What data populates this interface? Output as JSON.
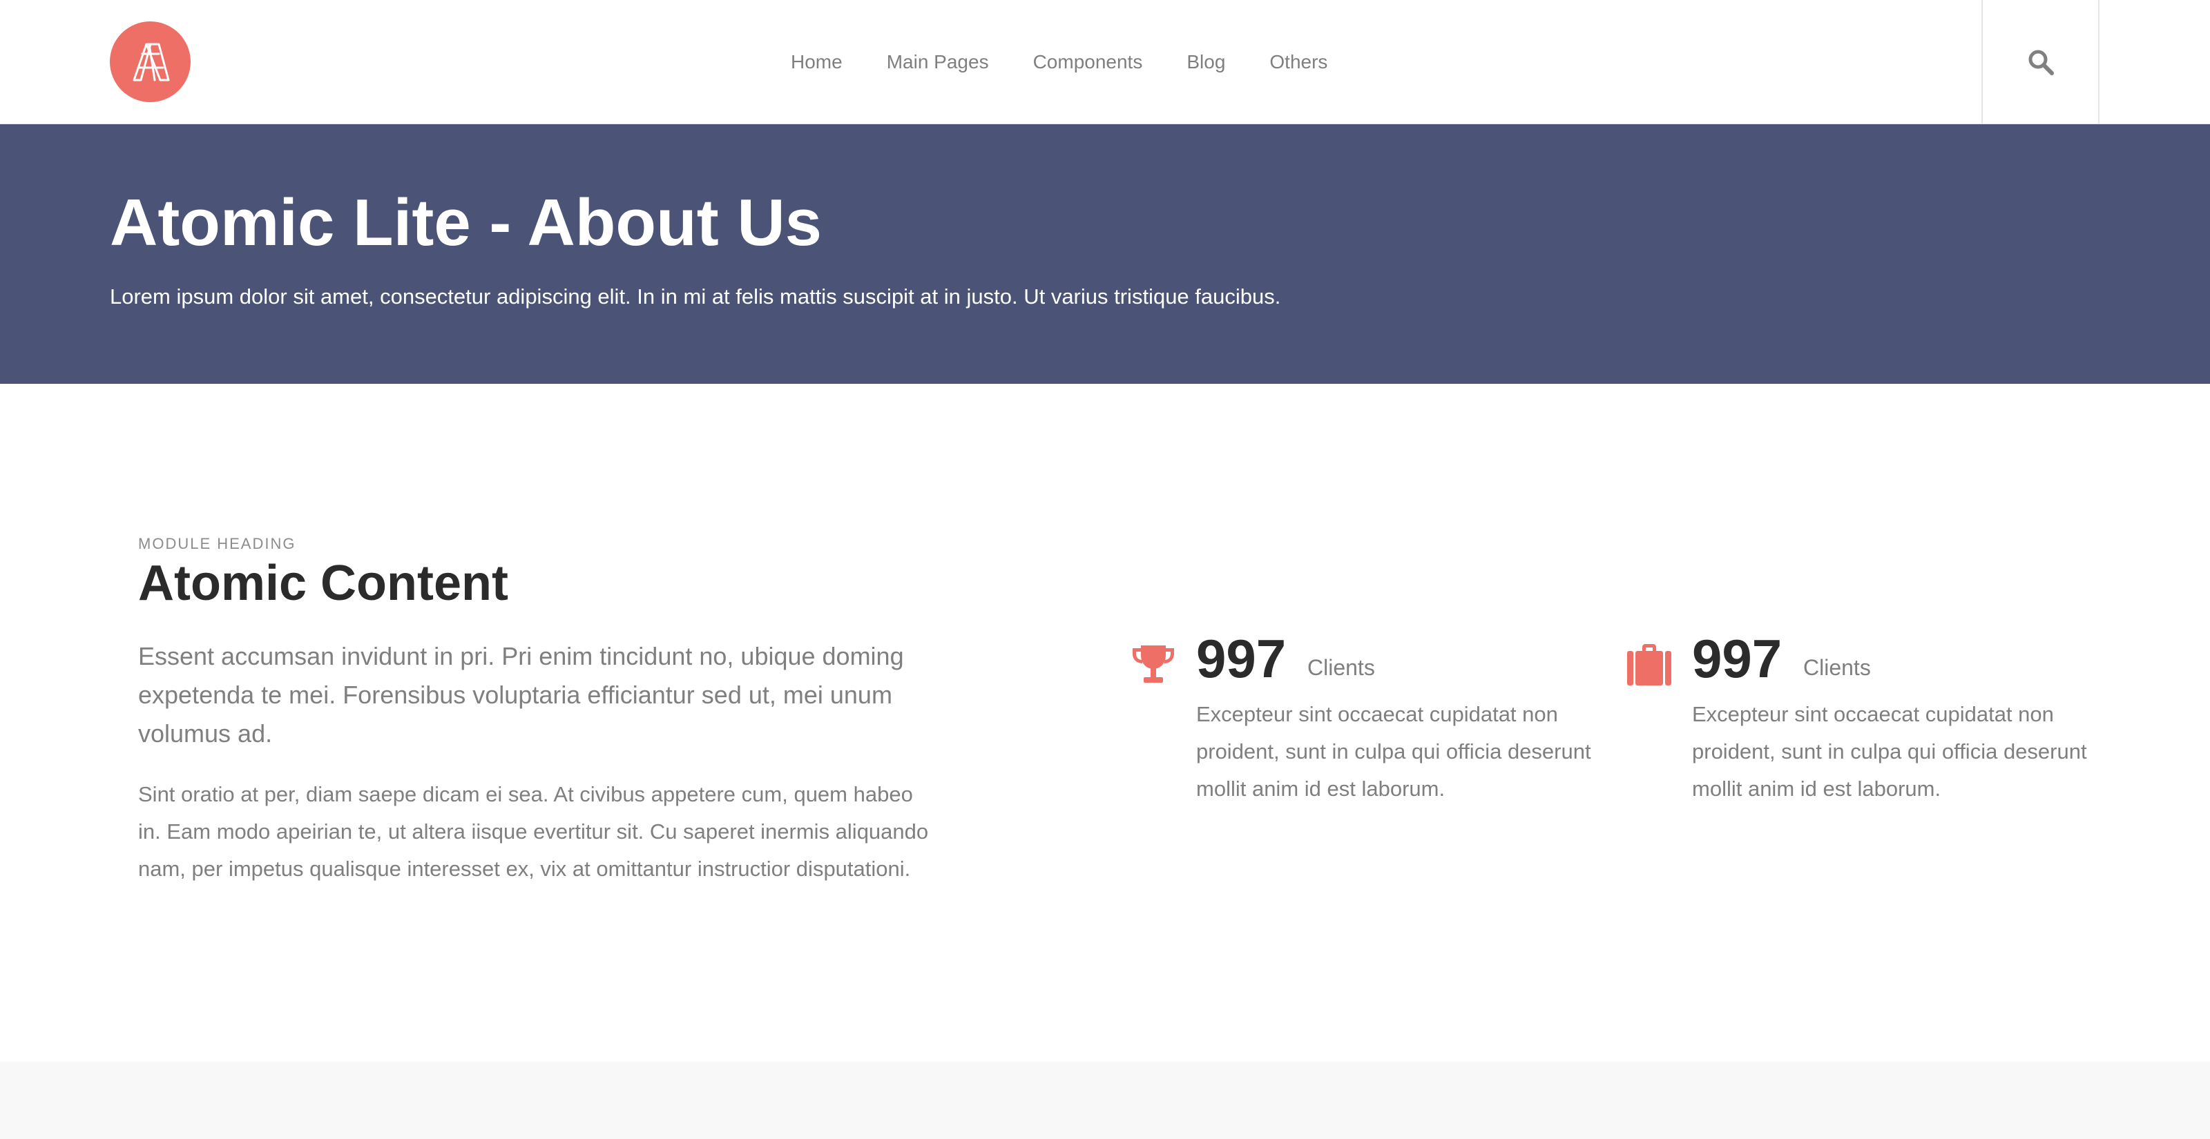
{
  "brand": {
    "logo_icon": "atomic-a-logo-icon",
    "accent_color": "#ee6f66",
    "hero_color": "#4b5477"
  },
  "nav": {
    "items": [
      {
        "label": "Home"
      },
      {
        "label": "Main Pages"
      },
      {
        "label": "Components"
      },
      {
        "label": "Blog"
      },
      {
        "label": "Others"
      }
    ],
    "search_icon": "search-icon"
  },
  "hero": {
    "title": "Atomic Lite - About Us",
    "subtitle": "Lorem ipsum dolor sit amet, consectetur adipiscing elit. In in mi at felis mattis suscipit at in justo. Ut varius tristique faucibus."
  },
  "content": {
    "eyebrow": "MODULE HEADING",
    "title": "Atomic Content",
    "lead": "Essent accumsan invidunt in pri. Pri enim tincidunt no, ubique doming expetenda te mei. Forensibus voluptaria efficiantur sed ut, mei unum volumus ad.",
    "body": "Sint oratio at per, diam saepe dicam ei sea. At civibus appetere cum, quem habeo in. Eam modo apeirian te, ut altera iisque evertitur sit. Cu saperet inermis aliquando nam, per impetus qualisque interesset ex, vix at omittantur instructior disputationi."
  },
  "stats": [
    {
      "icon": "trophy-icon",
      "number": "997",
      "label": "Clients",
      "description": "Excepteur sint occaecat cupidatat non proident, sunt in culpa qui officia deserunt mollit anim id est laborum."
    },
    {
      "icon": "briefcase-icon",
      "number": "997",
      "label": "Clients",
      "description": "Excepteur sint occaecat cupidatat non proident, sunt in culpa qui officia deserunt mollit anim id est laborum."
    }
  ]
}
